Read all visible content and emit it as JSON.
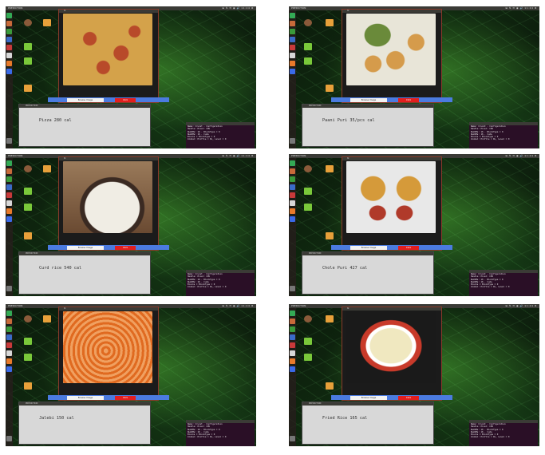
{
  "app": {
    "prediction_title": "PREDICTION",
    "image_window_title": "tk",
    "browse_label": "Browse Image",
    "click_label": "Click",
    "prediction_window_title": "PREDICTION"
  },
  "status_bar": {
    "right_text": "⊞ ⇅ ✉ ◉ 🔊 11:24 ⚙"
  },
  "desktop_icons": [
    "Home",
    "Untitled Folder",
    "NVIDIA",
    "NVIDIA",
    "NVIDIA",
    "Dataset",
    "Dataset"
  ],
  "terminal_lines": [
    "Name: Cruzst - Configuration",
    "Handle: Pixel: CPU",
    "NumSMs: 16  ·  BlockType = 0",
    "NumSMs: 16  ·  Cuda",
    "NumSMs: 16  ·  CudaCores: 1",
    "Blocks = BlockType = 0",
    "",
    "Global: Profile = DL,  Level = 0"
  ],
  "screenshots": [
    {
      "id": "pizza",
      "food": "Pizza",
      "calories": "280 cal",
      "label": "Pizza 280 cal",
      "photo_colors": [
        "#d4a24a",
        "#b84a2a",
        "#e9c98a"
      ]
    },
    {
      "id": "panipuri",
      "food": "Paani Puri",
      "calories": "35/pcs cal",
      "label": "Paani Puri 35/pcs cal",
      "photo_colors": [
        "#e8e5d8",
        "#d59b4b",
        "#6a8a3a"
      ]
    },
    {
      "id": "curdrice",
      "food": "Curd rice",
      "calories": "540 cal",
      "label": "Curd rice 540 cal",
      "photo_colors": [
        "#f0ede4",
        "#3a2a22",
        "#9a7a5a"
      ]
    },
    {
      "id": "cholepuri",
      "food": "Chole Puri",
      "calories": "427 cal",
      "label": "Chole Puri 427 cal",
      "photo_colors": [
        "#e8e8e8",
        "#d59a3a",
        "#b03a2a"
      ]
    },
    {
      "id": "jalebi",
      "food": "Jalebi",
      "calories": "150 cal",
      "label": "Jalebi 150 cal",
      "photo_colors": [
        "#f0a060",
        "#e06a20",
        "#7a6a8a"
      ]
    },
    {
      "id": "friedrice",
      "food": "Fried Rice",
      "calories": "165 cal",
      "label": "Fried Rice 165 cal",
      "photo_colors": [
        "#1a1a1a",
        "#f0e8c0",
        "#c83a2a"
      ]
    }
  ]
}
